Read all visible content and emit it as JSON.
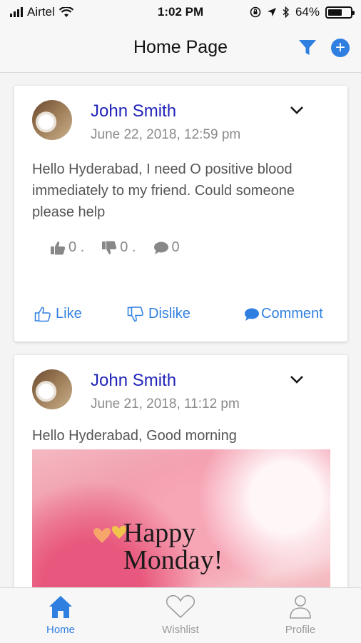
{
  "status_bar": {
    "carrier": "Airtel",
    "time": "1:02 PM",
    "battery": "64%",
    "battery_level": 0.64
  },
  "nav": {
    "title": "Home Page",
    "filter_icon": "filter-icon",
    "add_icon": "add-icon"
  },
  "posts": [
    {
      "author": "John Smith",
      "date": "June 22, 2018, 12:59 pm",
      "text": "Hello Hyderabad, I need O positive blood immediately to my friend. Could someone please help",
      "likes": "0 .",
      "dislikes": "0 .",
      "comments": "0",
      "like_label": "Like",
      "dislike_label": "Dislike",
      "comment_label": "Comment"
    },
    {
      "author": "John Smith",
      "date": "June 21, 2018, 11:12 pm",
      "text": "Hello Hyderabad, Good morning",
      "image_caption_line1": "Happy",
      "image_caption_line2": "Monday!"
    }
  ],
  "tabs": [
    {
      "label": "Home",
      "icon": "home-icon",
      "active": true
    },
    {
      "label": "Wishlist",
      "icon": "heart-icon",
      "active": false
    },
    {
      "label": "Profile",
      "icon": "user-icon",
      "active": false
    }
  ],
  "colors": {
    "accent": "#2f7fe0",
    "author": "#2124b8",
    "muted": "#8a8a8a"
  }
}
